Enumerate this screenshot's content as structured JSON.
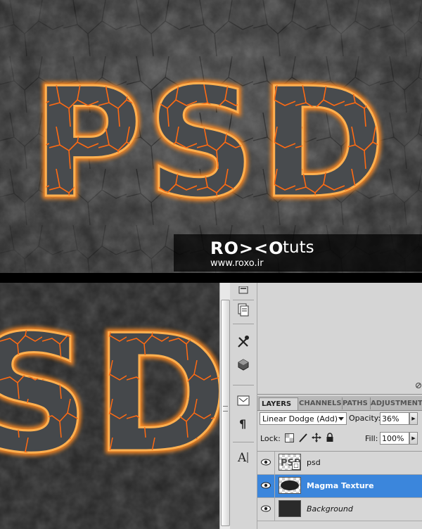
{
  "hero": {
    "artwork_text": "PSD",
    "brand_logo": "RO><O",
    "brand_suffix": "tuts",
    "brand_url": "www.roxo.ir"
  },
  "canvas": {
    "artwork_text": "SD"
  },
  "colors": {
    "lava": "#ff7a1a",
    "lava_glow": "#ffb347",
    "stone": "#4a4d50",
    "selection": "#3b86dc"
  },
  "tools": [
    {
      "icon": "notes-icon"
    },
    {
      "icon": "clone-source-icon"
    },
    {
      "icon": "tool-presets-icon"
    },
    {
      "icon": "3d-cube-icon"
    },
    {
      "icon": "navigator-icon"
    },
    {
      "icon": "paragraph-icon"
    },
    {
      "icon": "character-icon"
    }
  ],
  "layers_panel": {
    "tabs": [
      {
        "label": "LAYERS",
        "active": true
      },
      {
        "label": "CHANNELS",
        "active": false
      },
      {
        "label": "PATHS",
        "active": false
      },
      {
        "label": "ADJUSTMENT",
        "active": false
      }
    ],
    "blend_mode": "Linear Dodge (Add)",
    "opacity_label": "Opacity:",
    "opacity_value": "36%",
    "lock_label": "Lock:",
    "fill_label": "Fill:",
    "fill_value": "100%",
    "layers": [
      {
        "name": "psd",
        "selected": false,
        "italic": false,
        "thumbnail": "smart-object"
      },
      {
        "name": "Magma Texture",
        "selected": true,
        "italic": false,
        "thumbnail": "texture"
      },
      {
        "name": "Background",
        "selected": false,
        "italic": true,
        "thumbnail": "dark"
      }
    ]
  }
}
